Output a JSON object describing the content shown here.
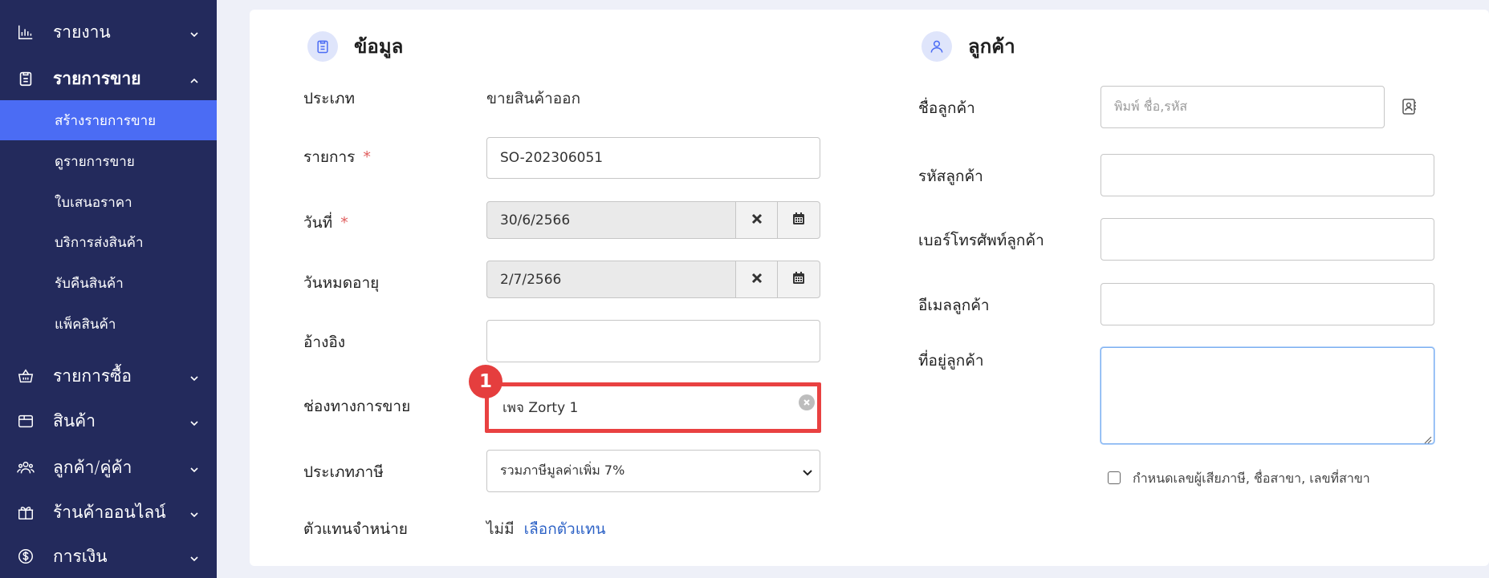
{
  "sidebar": {
    "items": [
      {
        "label": "รายงาน",
        "icon": "bar-chart-icon"
      },
      {
        "label": "รายการขาย",
        "icon": "clipboard-icon"
      },
      {
        "label": "รายการซื้อ",
        "icon": "basket-icon"
      },
      {
        "label": "สินค้า",
        "icon": "box-icon"
      },
      {
        "label": "ลูกค้า/คู่ค้า",
        "icon": "users-icon"
      },
      {
        "label": "ร้านค้าออนไลน์",
        "icon": "gift-icon"
      },
      {
        "label": "การเงิน",
        "icon": "dollar-icon"
      }
    ],
    "sales_sub": [
      {
        "label": "สร้างรายการขาย",
        "active": true
      },
      {
        "label": "ดูรายการขาย"
      },
      {
        "label": "ใบเสนอราคา"
      },
      {
        "label": "บริการส่งสินค้า"
      },
      {
        "label": "รับคืนสินค้า"
      },
      {
        "label": "แพ็คสินค้า"
      }
    ]
  },
  "info": {
    "title": "ข้อมูล",
    "type_label": "ประเภท",
    "type_value": "ขายสินค้าออก",
    "doc_label": "รายการ",
    "doc_value": "SO-202306051",
    "date_label": "วันที่",
    "date_value": "30/6/2566",
    "expire_label": "วันหมดอายุ",
    "expire_value": "2/7/2566",
    "ref_label": "อ้างอิง",
    "ref_value": "",
    "channel_label": "ช่องทางการขาย",
    "channel_value": "เพจ Zorty 1",
    "tax_label": "ประเภทภาษี",
    "tax_value": "รวมภาษีมูลค่าเพิ่ม 7%",
    "agent_label": "ตัวแทนจำหน่าย",
    "agent_value": "ไม่มี",
    "agent_link": "เลือกตัวแทน",
    "required_mark": "*",
    "callout_number": "1"
  },
  "customer": {
    "title": "ลูกค้า",
    "name_label": "ชื่อลูกค้า",
    "name_placeholder": "พิมพ์ ชื่อ,รหัส",
    "code_label": "รหัสลูกค้า",
    "phone_label": "เบอร์โทรศัพท์ลูกค้า",
    "email_label": "อีเมลลูกค้า",
    "address_label": "ที่อยู่ลูกค้า",
    "tax_checkbox_label": "กำหนดเลขผู้เสียภาษี, ชื่อสาขา, เลขที่สาขา"
  },
  "colors": {
    "sidebar_bg": "#232a5c",
    "active_bg": "#4b6cf4",
    "highlight": "#e94141",
    "link": "#2d62c6"
  }
}
